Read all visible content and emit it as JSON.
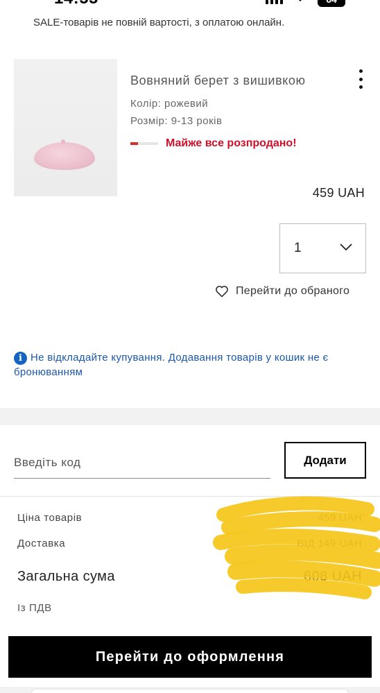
{
  "status": {
    "time": "14:55",
    "battery": "64"
  },
  "notice": {
    "text": "SALE-товарів не повній вартості, з оплатою онлайн."
  },
  "product": {
    "title": "Вовняний берет з вишивкою",
    "color": "Колір: рожевий",
    "size": "Розмір: 9-13 років",
    "stock": "Майже все розпродано!",
    "price": "459 UAH",
    "quantity": "1",
    "favorite": "Перейти до обраного"
  },
  "info": {
    "text": "Не відкладайте купування. Додавання товарів у кошик не є бронюванням"
  },
  "promo": {
    "placeholder": "Введіть код",
    "button": "Додати"
  },
  "summary": {
    "items_label": "Ціна товарів",
    "items_value": "459 UAH",
    "delivery_label": "Доставка",
    "delivery_value": "ВІД 149 UAH",
    "total_label": "Загальна сума",
    "total_value": "608 UAH",
    "vat_label": "Із ПДВ"
  },
  "checkout": {
    "label": "Перейти до оформлення"
  },
  "colors": {
    "accent_red": "#d0102a",
    "info_blue": "#1b57a8",
    "highlight_yellow": "#f5c518"
  }
}
